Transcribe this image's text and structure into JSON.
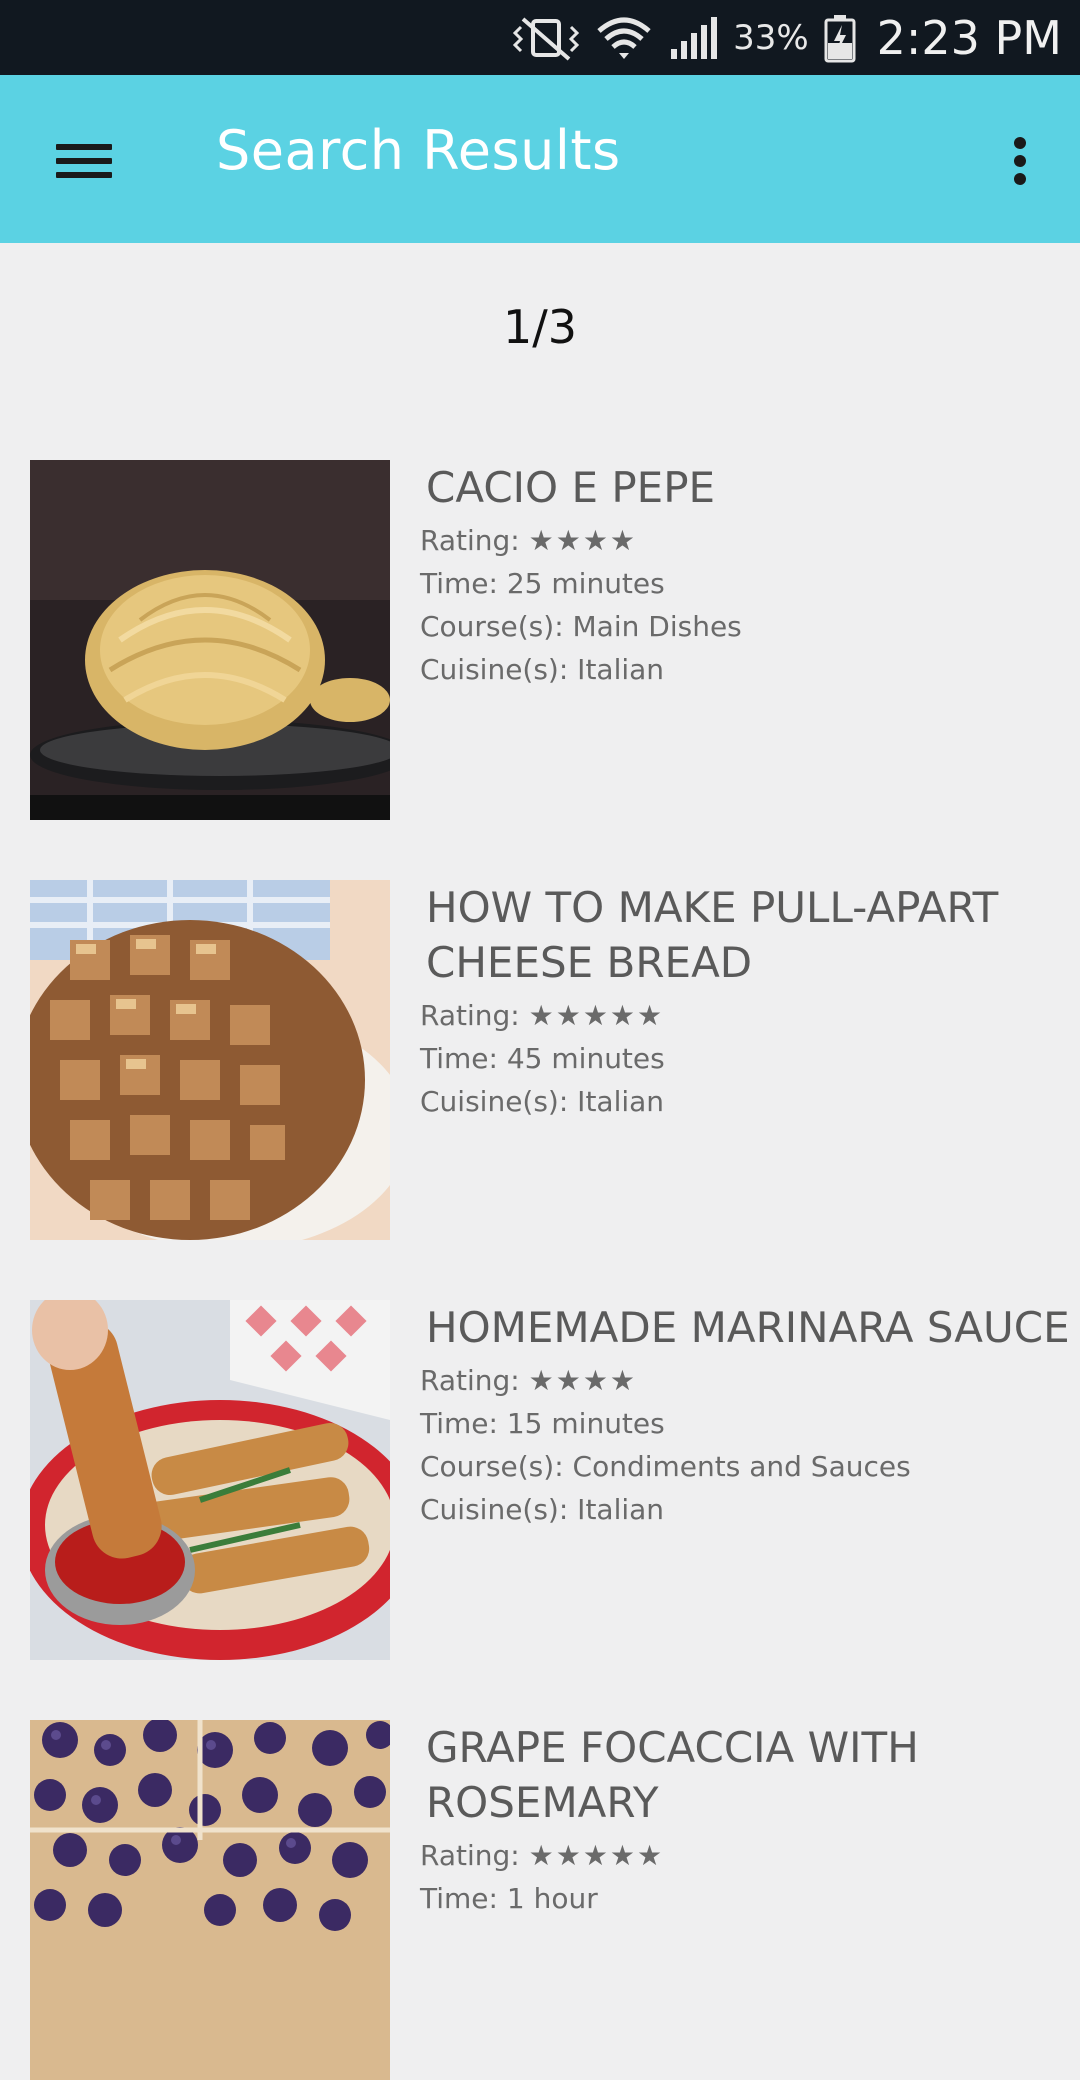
{
  "status_bar": {
    "battery_text": "33%",
    "time": "2:23 PM",
    "icons": [
      "mute-vibrate-icon",
      "wifi-icon",
      "signal-icon",
      "battery-charging-icon"
    ]
  },
  "app_bar": {
    "title": "Search Results",
    "menu_icon": "hamburger-menu-icon",
    "overflow_icon": "more-vertical-icon",
    "background": "#5bd2e3"
  },
  "pagination": {
    "text": "1/3"
  },
  "results": [
    {
      "title": "CACIO E PEPE",
      "rating_label": "Rating:",
      "stars_text": "★★★★",
      "rating": 4,
      "time": "Time: 25 minutes",
      "course": "Course(s): Main Dishes",
      "cuisine": "Cuisine(s): Italian"
    },
    {
      "title": "HOW TO MAKE PULL-APART CHEESE BREAD",
      "rating_label": "Rating:",
      "stars_text": "★★★★★",
      "rating": 5,
      "time": "Time: 45 minutes",
      "course": "",
      "cuisine": "Cuisine(s): Italian"
    },
    {
      "title": "HOMEMADE MARINARA SAUCE",
      "rating_label": "Rating:",
      "stars_text": "★★★★",
      "rating": 4,
      "time": "Time: 15 minutes",
      "course": "Course(s): Condiments and Sauces",
      "cuisine": "Cuisine(s): Italian"
    },
    {
      "title": "GRAPE FOCACCIA WITH ROSEMARY",
      "rating_label": "Rating:",
      "stars_text": "★★★★★",
      "rating": 5,
      "time": "Time: 1 hour",
      "course": "",
      "cuisine": ""
    }
  ]
}
